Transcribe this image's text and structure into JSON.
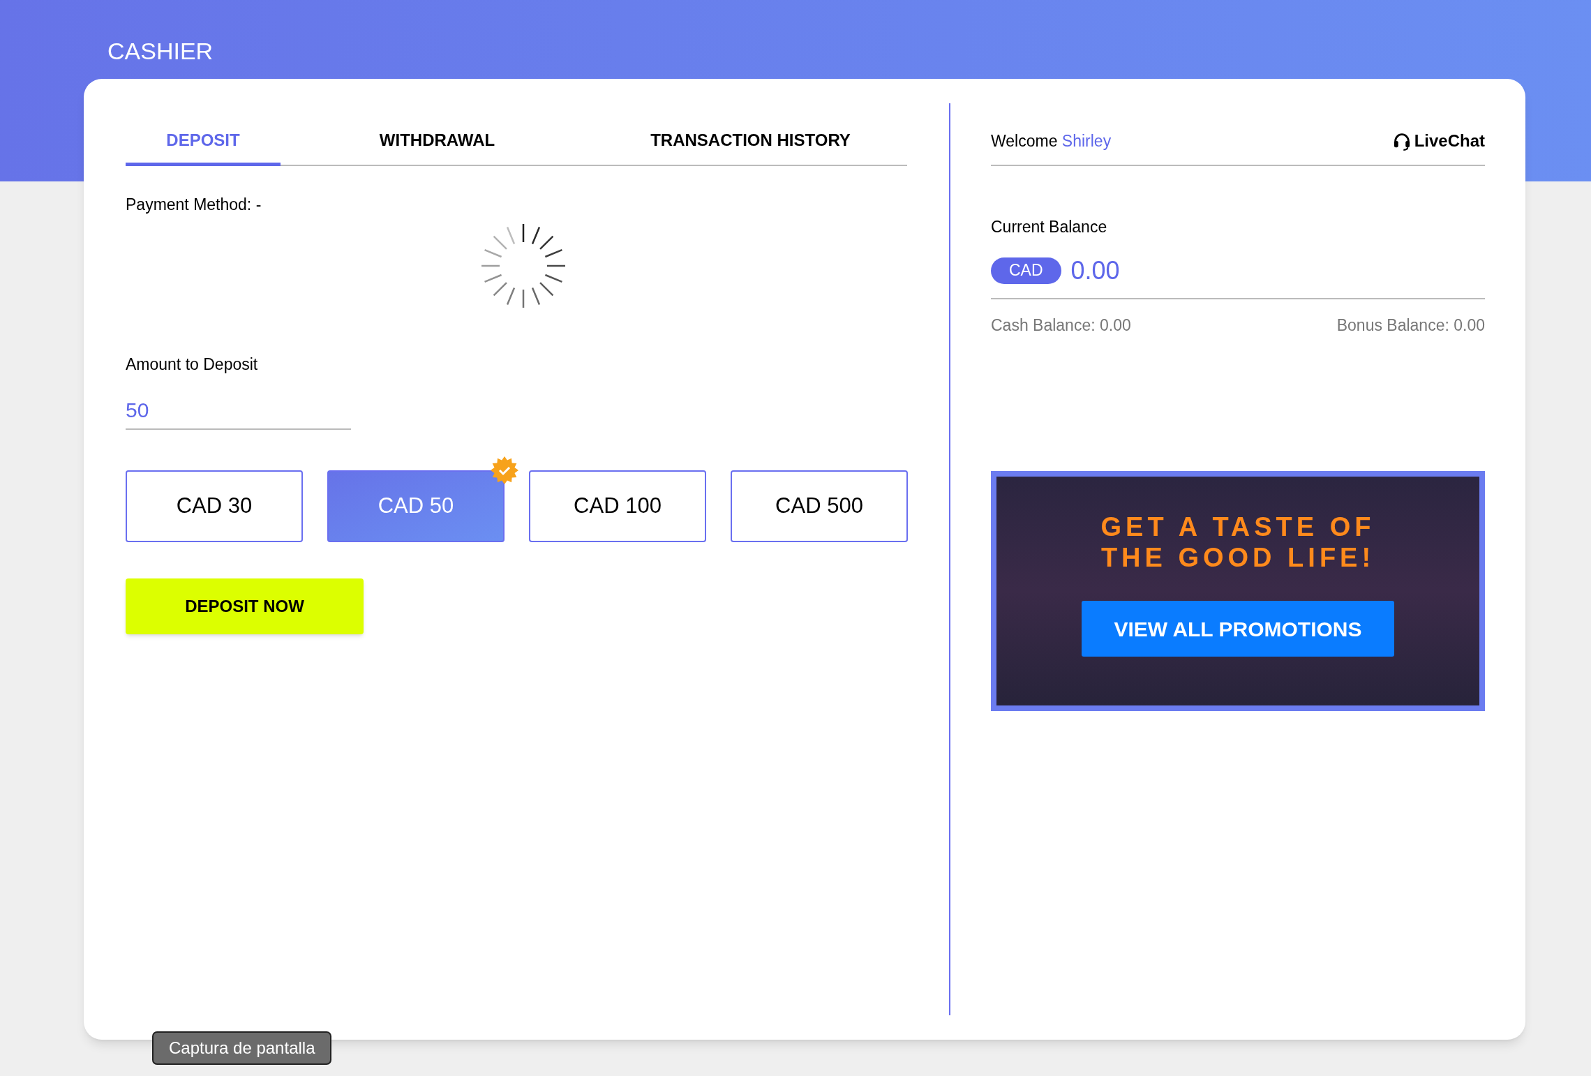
{
  "header": {
    "title": "CASHIER"
  },
  "tabs": [
    {
      "label": "DEPOSIT",
      "selected": true
    },
    {
      "label": "WITHDRAWAL",
      "selected": false
    },
    {
      "label": "TRANSACTION HISTORY",
      "selected": false
    }
  ],
  "payment_method": {
    "label": "Payment Method: -"
  },
  "amount": {
    "label": "Amount to Deposit",
    "value": "50"
  },
  "amount_options": [
    {
      "label": "CAD 30",
      "selected": false
    },
    {
      "label": "CAD 50",
      "selected": true
    },
    {
      "label": "CAD 100",
      "selected": false
    },
    {
      "label": "CAD 500",
      "selected": false
    }
  ],
  "deposit_button": "DEPOSIT NOW",
  "welcome": {
    "greeting": "Welcome",
    "name": "Shirley"
  },
  "livechat": "LiveChat",
  "balance": {
    "label": "Current Balance",
    "currency": "CAD",
    "amount": "0.00",
    "cash": "Cash Balance: 0.00",
    "bonus": "Bonus Balance: 0.00"
  },
  "promo": {
    "headline": [
      "GET A TASTE OF",
      "THE GOOD LIFE!"
    ],
    "button": "VIEW ALL PROMOTIONS"
  },
  "tooltip": "Captura de pantalla"
}
